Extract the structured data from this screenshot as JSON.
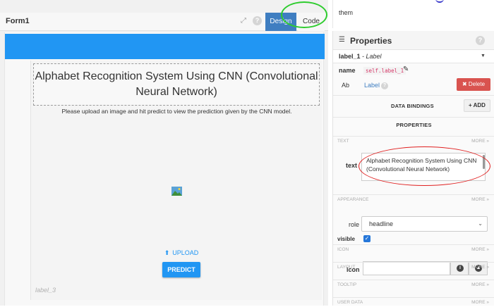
{
  "form": {
    "title": "Form1",
    "design_tab": "Design",
    "code_tab": "Code",
    "help": "?"
  },
  "canvas": {
    "headline": "Alphabet Recognition System Using CNN (Convolutional Neural Network)",
    "subtext": "Please upload an image and hit predict to view the prediction given by the CNN model.",
    "upload_label": "UPLOAD",
    "predict_label": "PREDICT",
    "label3": "label_3"
  },
  "top_strip": {
    "text": "them"
  },
  "properties": {
    "title": "Properties",
    "help": "?",
    "component_name": "label_1",
    "component_separator": " - ",
    "component_type": "Label",
    "name_label": "name",
    "name_value": "self.label_1",
    "ab_text": "Ab",
    "label_link": "Label",
    "delete_label": "✖ Delete",
    "data_bindings_label": "DATA BINDINGS",
    "add_label": "+ ADD",
    "properties_heading": "PROPERTIES",
    "sections": {
      "text": "TEXT",
      "appearance": "APPEARANCE",
      "icon": "ICON",
      "layout": "LAYOUT",
      "tooltip": "TOOLTIP",
      "user_data": "USER DATA",
      "more": "MORE »"
    },
    "text_field_label": "text",
    "text_value": "Alphabet Recognition System Using CNN (Convolutional Neural Network)",
    "role_label": "role",
    "role_value": "headline",
    "visible_label": "visible",
    "visible_checked": true,
    "icon_label": "icon",
    "icon_value": ""
  },
  "colors": {
    "accent_blue": "#2196f3",
    "design_tab": "#3f7ec1",
    "delete_red": "#d9534f",
    "annotation_red": "#e02020",
    "annotation_green": "#2ecc2e"
  }
}
